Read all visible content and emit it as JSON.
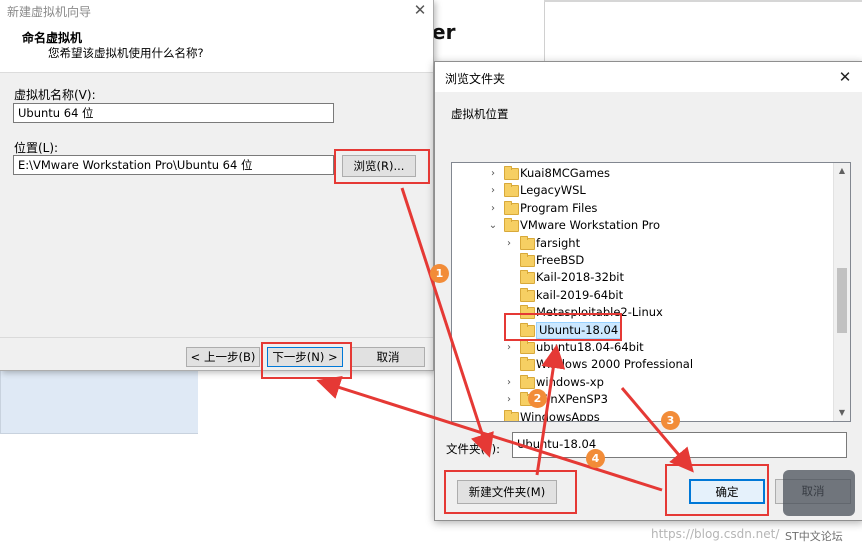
{
  "background": {
    "heading": "er"
  },
  "wizard": {
    "title": "新建虚拟机向导",
    "heading": "命名虚拟机",
    "subheading": "您希望该虚拟机使用什么名称?",
    "name_label": "虚拟机名称(V):",
    "name_value": "Ubuntu 64 位",
    "location_label": "位置(L):",
    "location_value": "E:\\VMware Workstation Pro\\Ubuntu 64 位",
    "browse_label": "浏览(R)...",
    "back_label": "< 上一步(B)",
    "next_label": "下一步(N) >",
    "cancel_label": "取消"
  },
  "browse_dialog": {
    "title": "浏览文件夹",
    "prompt": "虚拟机位置",
    "folder_label": "文件夹(F):",
    "folder_value": "Ubuntu-18.04",
    "new_folder_label": "新建文件夹(M)",
    "ok_label": "确定",
    "cancel_label": "取消",
    "tree": [
      {
        "label": "Kuai8MCGames",
        "expand": "collapsed"
      },
      {
        "label": "LegacyWSL",
        "expand": "collapsed"
      },
      {
        "label": "Program Files",
        "expand": "collapsed"
      },
      {
        "label": "VMware Workstation Pro",
        "expand": "expanded"
      },
      {
        "label": "farsight",
        "expand": "collapsed"
      },
      {
        "label": "FreeBSD",
        "expand": "none"
      },
      {
        "label": "Kail-2018-32bit",
        "expand": "none"
      },
      {
        "label": "kail-2019-64bit",
        "expand": "none"
      },
      {
        "label": "Metasploitable2-Linux",
        "expand": "none"
      },
      {
        "label": "Ubuntu-18.04",
        "expand": "none",
        "selected": true
      },
      {
        "label": "ubuntu18.04-64bit",
        "expand": "collapsed"
      },
      {
        "label": "Windows 2000 Professional",
        "expand": "none"
      },
      {
        "label": "windows-xp",
        "expand": "collapsed"
      },
      {
        "label": "WinXPenSP3",
        "expand": "collapsed"
      },
      {
        "label": "WindowsApps",
        "expand": "none"
      }
    ]
  },
  "annotations": {
    "badges": [
      "1",
      "2",
      "3",
      "4"
    ],
    "color": "#e53935",
    "badge_color": "#f28c38"
  },
  "watermark": {
    "url": "https://blog.csdn.net/",
    "forum": "ST中文论坛"
  }
}
